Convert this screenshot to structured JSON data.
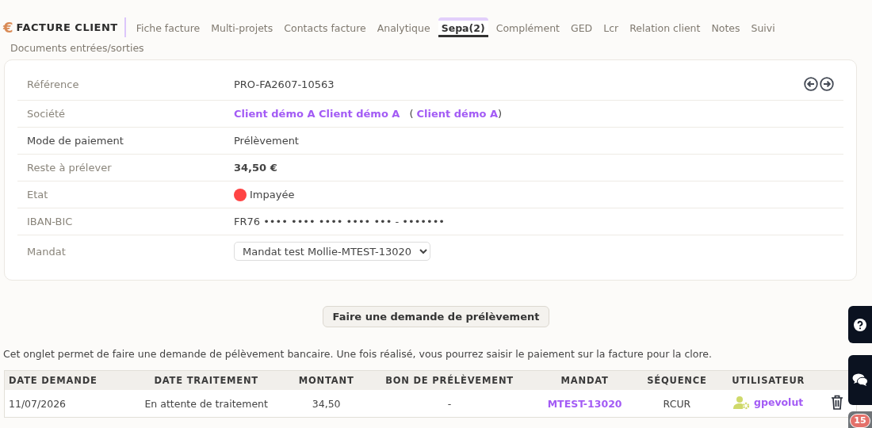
{
  "header": {
    "currency_symbol": "€",
    "title": "FACTURE CLIENT"
  },
  "tabs": [
    {
      "label": "Fiche facture",
      "selected": false
    },
    {
      "label": "Multi-projets",
      "selected": false
    },
    {
      "label": "Contacts facture",
      "selected": false
    },
    {
      "label": "Analytique",
      "selected": false
    },
    {
      "label": "Sepa(2)",
      "selected": true
    },
    {
      "label": "Complément",
      "selected": false
    },
    {
      "label": "GED",
      "selected": false
    },
    {
      "label": "Lcr",
      "selected": false
    },
    {
      "label": "Relation client",
      "selected": false
    },
    {
      "label": "Notes",
      "selected": false
    },
    {
      "label": "Suivi",
      "selected": false
    },
    {
      "label": "Documents entrées/sorties",
      "selected": false
    }
  ],
  "fields": [
    {
      "kind": "text",
      "label": "Référence",
      "value": "PRO-FA2607-10563"
    },
    {
      "kind": "links",
      "label": "Société",
      "links": [
        "Client démo A Client démo A",
        "Client démo A"
      ],
      "open": "(",
      "close": ")"
    },
    {
      "kind": "text",
      "label": "Mode de paiement",
      "value": "Prélèvement"
    },
    {
      "kind": "bold",
      "label": "Reste à prélever",
      "value": "34,50 €"
    },
    {
      "kind": "status",
      "label": "Etat",
      "value": "Impayée",
      "color": "#ff4444"
    },
    {
      "kind": "text",
      "label": "IBAN-BIC",
      "value": "FR76 •••• •••• •••• •••• ••• - •••••••"
    },
    {
      "kind": "select",
      "label": "Mandat",
      "value": "Mandat test Mollie-MTEST-13020"
    }
  ],
  "request_button": "Faire une demande de prélèvement",
  "info_text": "Cet onglet permet de faire une demande de pélèvement bancaire. Une fois réalisé, vous pourrez saisir le paiement sur la facture pour la clore.",
  "table": {
    "columns": [
      "DATE DEMANDE",
      "DATE TRAITEMENT",
      "MONTANT",
      "BON DE PRÉLÈVEMENT",
      "MANDAT",
      "SÉQUENCE",
      "UTILISATEUR"
    ],
    "rows": [
      {
        "date_demande": "11/07/2026",
        "date_traitement": "En attente de traitement",
        "montant": "34,50",
        "bon": "-",
        "mandat": "MTEST-13020",
        "sequence": "RCUR",
        "utilisateur": "gpevolut"
      }
    ]
  },
  "notification_count": "15"
}
